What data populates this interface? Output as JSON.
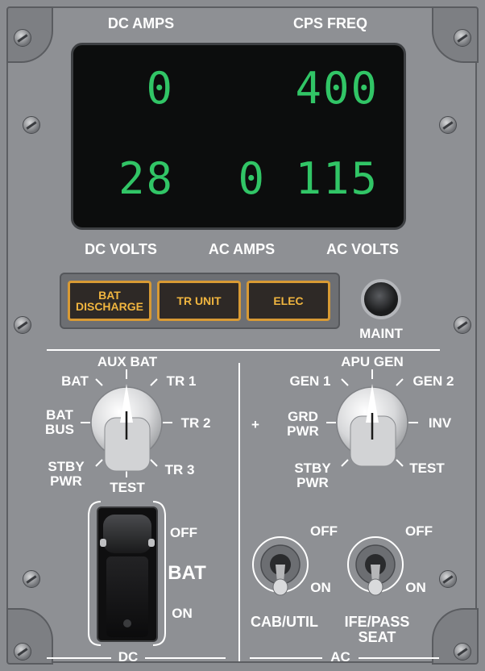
{
  "display": {
    "dc_amps_label": "DC AMPS",
    "cps_freq_label": "CPS FREQ",
    "dc_amps_value": "0",
    "cps_freq_value": "400",
    "dc_volts_value": "28",
    "ac_amps_value": "0",
    "ac_volts_value": "115",
    "dc_volts_label": "DC VOLTS",
    "ac_amps_label": "AC AMPS",
    "ac_volts_label": "AC VOLTS",
    "digit_color": "#31c566"
  },
  "annunciators": {
    "bat_discharge_line1": "BAT",
    "bat_discharge_line2": "DISCHARGE",
    "tr_unit": "TR UNIT",
    "elec": "ELEC",
    "maint_label": "MAINT",
    "light_color": "#f0b53f"
  },
  "dc_selector": {
    "aux_bat": "AUX BAT",
    "bat": "BAT",
    "tr1": "TR 1",
    "bat_bus_line1": "BAT",
    "bat_bus_line2": "BUS",
    "tr2": "TR 2",
    "stby_pwr_line1": "STBY",
    "stby_pwr_line2": "PWR",
    "tr3": "TR 3",
    "test": "TEST"
  },
  "ac_selector": {
    "apu_gen": "APU GEN",
    "gen1": "GEN 1",
    "gen2": "GEN 2",
    "grd_pwr_line1": "GRD",
    "grd_pwr_line2": "PWR",
    "inv": "INV",
    "stby_pwr_line1": "STBY",
    "stby_pwr_line2": "PWR",
    "test": "TEST",
    "plus": "+"
  },
  "bat_switch": {
    "off": "OFF",
    "label": "BAT",
    "on": "ON"
  },
  "toggles": {
    "cab_off": "OFF",
    "cab_on": "ON",
    "cab_label": "CAB/UTIL",
    "ife_off": "OFF",
    "ife_on": "ON",
    "ife_label_line1": "IFE/PASS",
    "ife_label_line2": "SEAT"
  },
  "sections": {
    "dc": "DC",
    "ac": "AC"
  }
}
